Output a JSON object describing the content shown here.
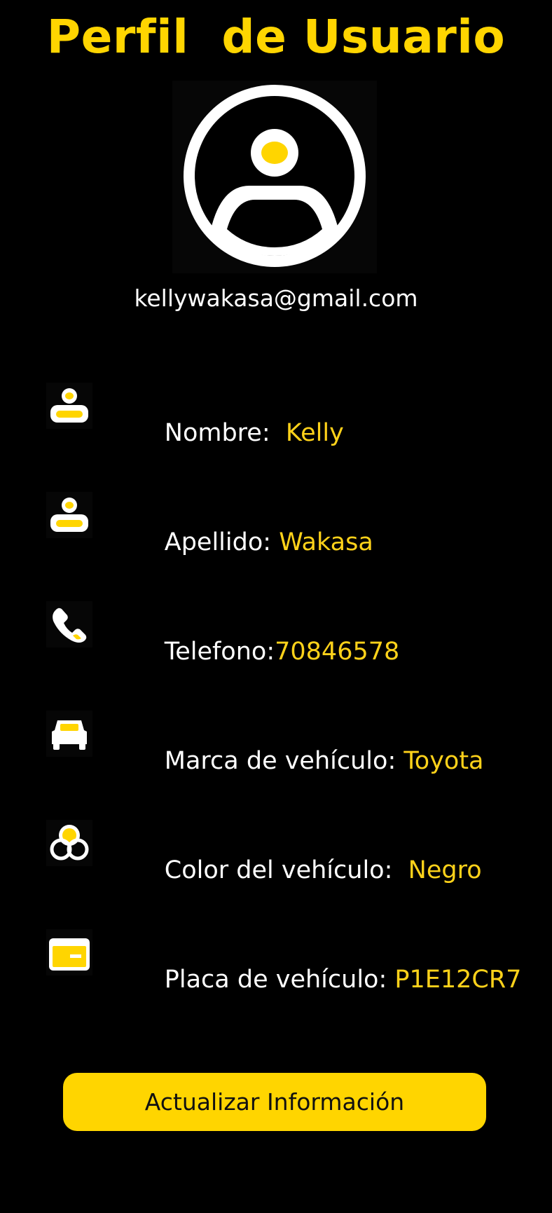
{
  "header": {
    "title": "Perfil  de Usuario"
  },
  "profile": {
    "avatar_icon": "user-circle-icon",
    "email": "kellywakasa@gmail.com"
  },
  "fields": [
    {
      "icon": "user-icon",
      "label": "Nombre:  ",
      "value": "Kelly"
    },
    {
      "icon": "user-icon",
      "label": "Apellido: ",
      "value": "Wakasa"
    },
    {
      "icon": "phone-icon",
      "label": "Telefono:",
      "value": "70846578"
    },
    {
      "icon": "car-icon",
      "label": "Marca de vehículo: ",
      "value": "Toyota"
    },
    {
      "icon": "color-circles-icon",
      "label": "Color del vehículo:  ",
      "value": "Negro"
    },
    {
      "icon": "card-plate-icon",
      "label": "Placa de vehículo: ",
      "value": "P1E12CR7"
    }
  ],
  "actions": {
    "update_label": "Actualizar Información"
  },
  "colors": {
    "background": "#000000",
    "accent": "#FFD500",
    "text": "#FFFFFF"
  }
}
